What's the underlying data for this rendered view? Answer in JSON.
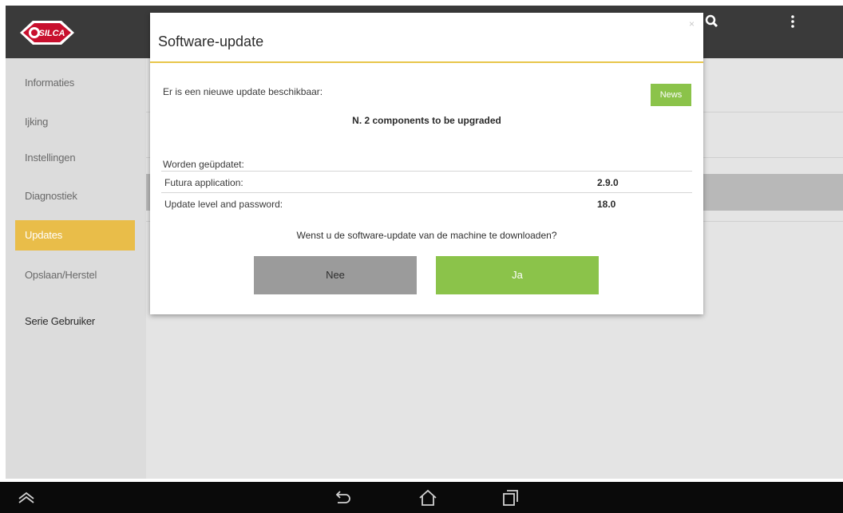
{
  "app": {
    "brand_color": "#c8102e",
    "accent_color": "#e9bd49"
  },
  "appbar": {
    "logo_text": "SILCA",
    "icons": [
      "search-icon",
      "overflow-menu-icon"
    ]
  },
  "sidebar": {
    "items": [
      {
        "label": "Informaties",
        "active": false
      },
      {
        "label": "Ijking",
        "active": false
      },
      {
        "label": "Instellingen",
        "active": false
      },
      {
        "label": "Diagnostiek",
        "active": false
      },
      {
        "label": "Updates",
        "active": true
      },
      {
        "label": "Opslaan/Herstel",
        "active": false
      },
      {
        "label": "Serie Gebruiker",
        "active": false
      }
    ]
  },
  "dialog": {
    "title": "Software-update",
    "close_glyph": "×",
    "available_text": "Er is een nieuwe update beschikbaar:",
    "news_label": "News",
    "components_text": "N. 2 components to be upgraded",
    "updated_label": "Worden geüpdatet:",
    "rows": [
      {
        "name": "Futura application:",
        "value": "2.9.0"
      },
      {
        "name": "Update level and password:",
        "value": "18.0"
      }
    ],
    "question": "Wenst u de software-update van de machine te downloaden?",
    "no_label": "Nee",
    "yes_label": "Ja",
    "colors": {
      "rule": "#e8c64a",
      "yes_button": "#8bc34a",
      "no_button": "#9b9b9b"
    }
  },
  "navbar": {
    "icons": [
      "collapse-icon",
      "back-icon",
      "home-icon",
      "recent-apps-icon"
    ]
  }
}
